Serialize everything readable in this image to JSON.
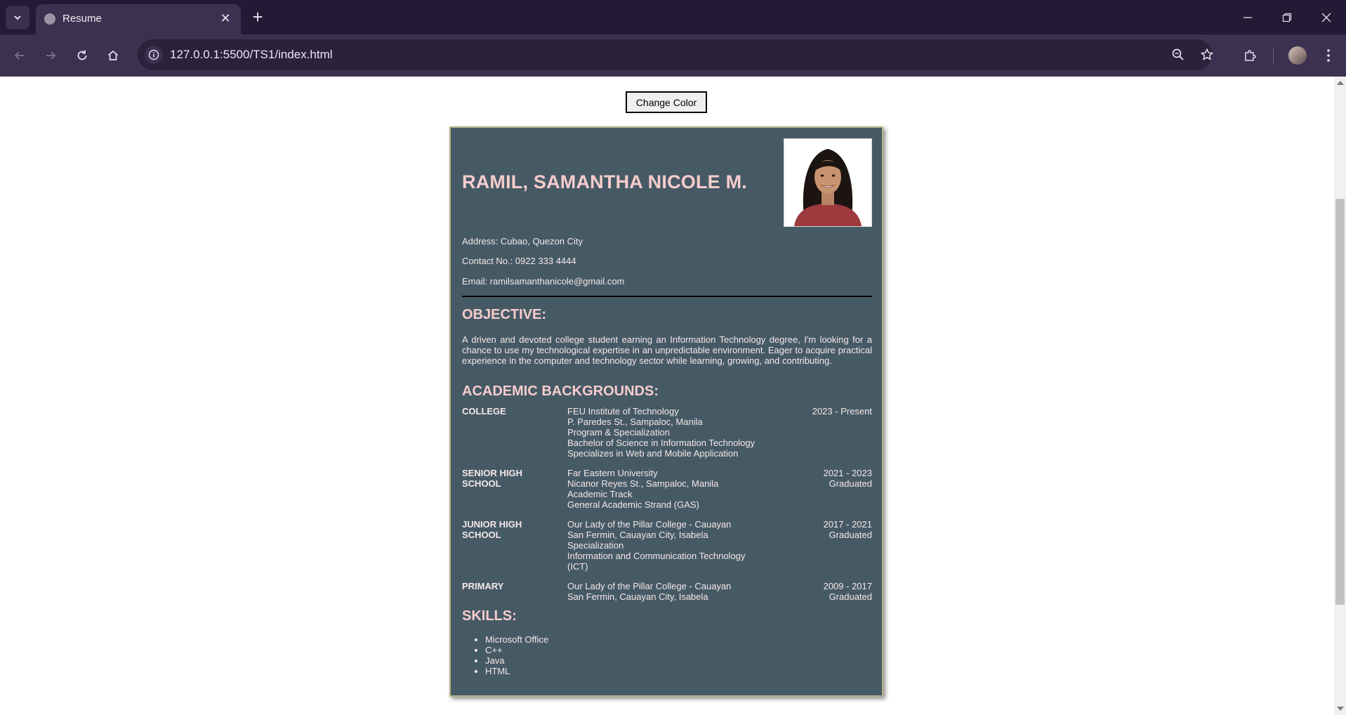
{
  "browser": {
    "tab_title": "Resume",
    "url": "127.0.0.1:5500/TS1/index.html"
  },
  "page": {
    "change_color_label": "Change Color"
  },
  "resume": {
    "name": "RAMIL, SAMANTHA NICOLE M.",
    "address": "Address: Cubao, Quezon City",
    "contact": "Contact No.: 0922 333 4444",
    "email": "Email: ramilsamanthanicole@gmail.com",
    "objective_title": "OBJECTIVE:",
    "objective_text": "A driven and devoted college student earning an Information Technology degree, I'm looking for a chance to use my technological expertise in an unpredictable environment. Eager to acquire practical experience in the computer and technology sector while learning, growing, and contributing.",
    "academic_title": "ACADEMIC BACKGROUNDS:",
    "education": [
      {
        "level": "COLLEGE",
        "details": [
          "FEU Institute of Technology",
          "P. Paredes St., Sampaloc, Manila",
          "Program & Specialization",
          "Bachelor of Science in Information Technology",
          "Specializes in Web and Mobile Application"
        ],
        "date": [
          "2023 - Present"
        ]
      },
      {
        "level": "SENIOR HIGH SCHOOL",
        "details": [
          "Far Eastern University",
          "Nicanor Reyes St., Sampaloc, Manila",
          "Academic Track",
          "General Academic Strand (GAS)"
        ],
        "date": [
          "2021 - 2023",
          "Graduated"
        ]
      },
      {
        "level": "JUNIOR HIGH SCHOOL",
        "details": [
          "Our Lady of the Pillar College - Cauayan",
          "San Fermin, Cauayan City, Isabela",
          "Specialization",
          "Information and Communication Technology",
          "(ICT)"
        ],
        "date": [
          "2017 - 2021",
          "Graduated"
        ]
      },
      {
        "level": "PRIMARY",
        "details": [
          "Our Lady of the Pillar College - Cauayan",
          "San Fermin, Cauayan City, Isabela"
        ],
        "date": [
          "2009 - 2017",
          "Graduated"
        ]
      }
    ],
    "skills_title": "SKILLS:",
    "skills": [
      "Microsoft Office",
      "C++",
      "Java",
      "HTML"
    ]
  },
  "colors": {
    "resume_bg": "#465a66",
    "heading": "#f6cccc",
    "text": "#f5e8e8"
  }
}
